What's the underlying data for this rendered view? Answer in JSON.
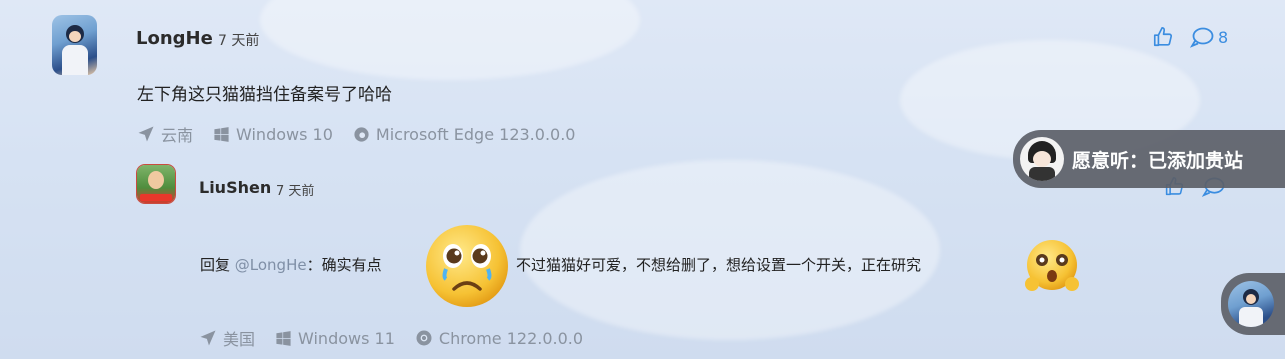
{
  "comment": {
    "author": "LongHe",
    "time": "7 天前",
    "text": "左下角这只猫猫挡住备案号了哈哈",
    "likes_icon": "thumbs-up-icon",
    "reply_count": "8",
    "meta": {
      "location": "云南",
      "os": "Windows 10",
      "browser": "Microsoft Edge 123.0.0.0"
    }
  },
  "reply": {
    "author": "LiuShen",
    "time": "7 天前",
    "prefix": "回复 ",
    "mention": "@LongHe",
    "colon": "：确实有点",
    "text_after": "不过猫猫好可爱，不想给删了，想给设置一个开关，正在研究",
    "meta": {
      "location": "美国",
      "os": "Windows 11",
      "browser": "Chrome 122.0.0.0"
    }
  },
  "music_pill": {
    "text": "愿意听：已添加贵站"
  },
  "colors": {
    "accent": "#3b8de0",
    "pill_bg": "#5c5f68",
    "meta_text": "#8a93a0"
  }
}
